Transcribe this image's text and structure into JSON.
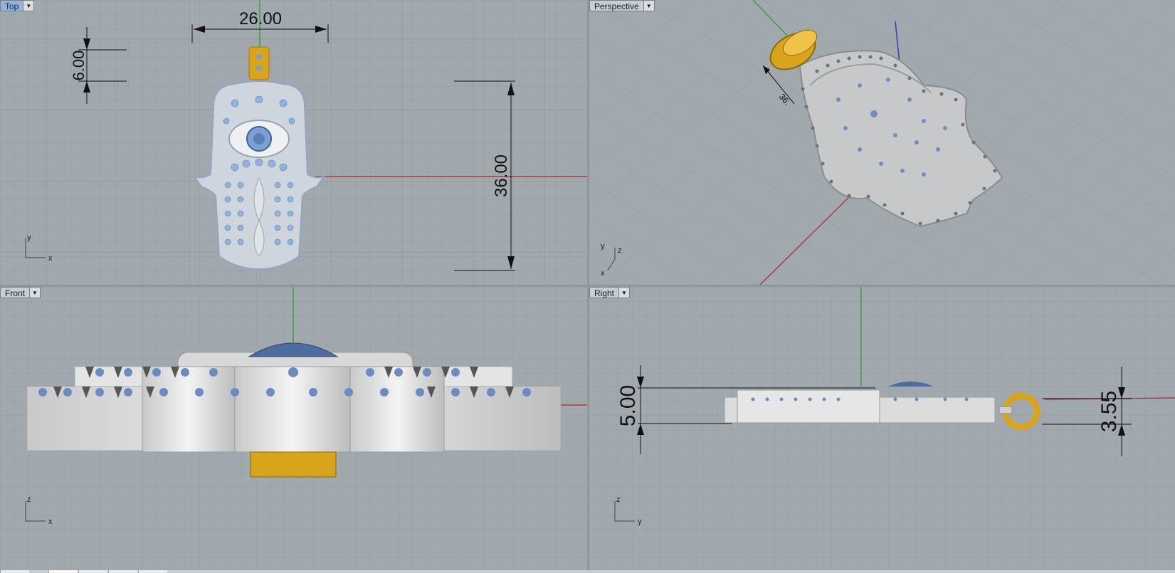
{
  "viewports": {
    "top": {
      "label": "Top",
      "menu_icon": "dropdown-arrow-icon",
      "active": true,
      "dimensions": [
        "26.00",
        "6.00",
        "36.00"
      ],
      "axes": [
        "y",
        "x"
      ]
    },
    "perspective": {
      "label": "Perspective",
      "menu_icon": "dropdown-arrow-icon",
      "dimensions": [
        "36."
      ],
      "axes": [
        "y",
        "z",
        "x"
      ]
    },
    "front": {
      "label": "Front",
      "menu_icon": "dropdown-arrow-icon",
      "axes": [
        "z",
        "x"
      ]
    },
    "right": {
      "label": "Right",
      "menu_icon": "dropdown-arrow-icon",
      "dimensions": [
        "5.00",
        "3.55"
      ],
      "axes": [
        "z",
        "y"
      ]
    }
  },
  "colors": {
    "viewport_bg": "#a1a8ae",
    "grid_minor": "#989fa5",
    "grid_major": "#8d949a",
    "x_axis": "#b23a3a",
    "y_axis": "#3aa03a",
    "z_axis": "#3a3ac0",
    "metal_silver": "#d8d8d8",
    "metal_gold": "#d8a41c",
    "gem_blue": "#7aa0d4",
    "active_label": "#8fb3d9"
  }
}
